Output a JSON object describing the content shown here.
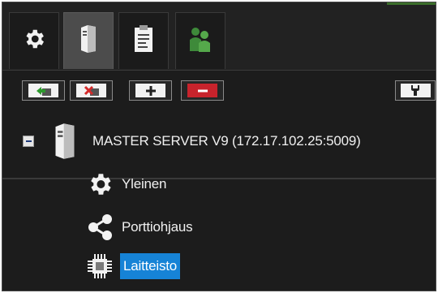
{
  "tabs": [
    {
      "icon": "gear-icon",
      "active": false
    },
    {
      "icon": "server-icon",
      "active": true
    },
    {
      "icon": "clipboard-icon",
      "active": false
    },
    {
      "icon": "users-icon",
      "active": false
    }
  ],
  "toolbar": {
    "buttons": [
      {
        "icon": "add-server-icon"
      },
      {
        "icon": "remove-server-icon"
      },
      {
        "icon": "plus-icon"
      },
      {
        "icon": "minus-icon"
      },
      {
        "icon": "wrench-icon"
      }
    ]
  },
  "tree": {
    "root": {
      "label": "MASTER SERVER V9 (172.17.102.25:5009)",
      "expanded": true,
      "icon": "server-icon"
    },
    "children": [
      {
        "label": "Yleinen",
        "icon": "gear-icon",
        "selected": false
      },
      {
        "label": "Porttiohjaus",
        "icon": "share-icon",
        "selected": false
      },
      {
        "label": "Laitteisto",
        "icon": "chip-icon",
        "selected": true
      }
    ]
  },
  "colors": {
    "background": "#1c1c1c",
    "selection": "#1683d6",
    "danger": "#c8232c"
  }
}
